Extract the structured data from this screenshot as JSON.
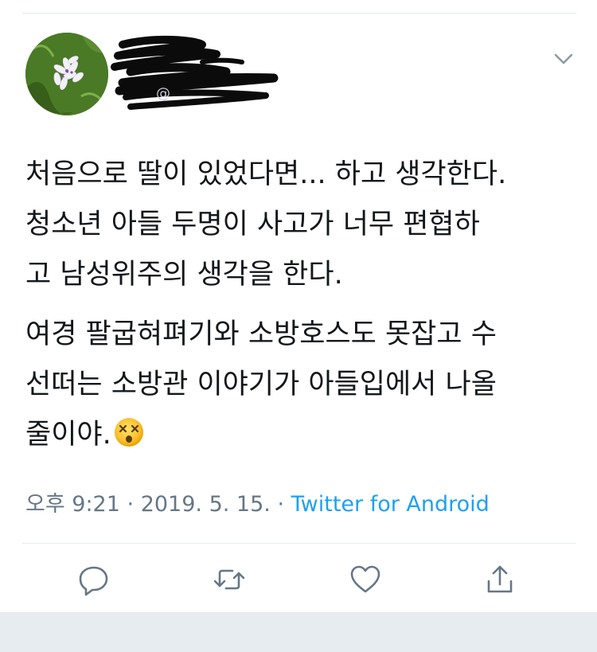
{
  "tweet": {
    "paragraphs": [
      {
        "lines": [
          "처음으로 딸이 있었다면... 하고 생각한다.",
          "청소년 아들 두명이 사고가 너무 편협하",
          "고 남성위주의 생각을 한다."
        ]
      },
      {
        "lines": [
          "여경 팔굽혀펴기와 소방호스도 못잡고 수",
          "선떠는 소방관 이야기가 아들입에서 나올",
          "줄이야."
        ],
        "trailing_emoji": "dizzy-face-emoji"
      }
    ],
    "time": "오후 9:21",
    "separator": "·",
    "date": "2019. 5. 15.",
    "source": "Twitter for Android"
  },
  "author": {
    "avatar_icon": "flower-avatar",
    "name_redacted": true
  },
  "actions": [
    {
      "name": "reply",
      "icon": "speech-bubble-icon"
    },
    {
      "name": "retweet",
      "icon": "retweet-arrows-icon"
    },
    {
      "name": "like",
      "icon": "heart-icon"
    },
    {
      "name": "share",
      "icon": "share-upload-icon"
    }
  ],
  "colors": {
    "text": "#14171a",
    "muted": "#657786",
    "link": "#1da1f2",
    "divider": "#e6ecf0",
    "icon": "#657786"
  }
}
